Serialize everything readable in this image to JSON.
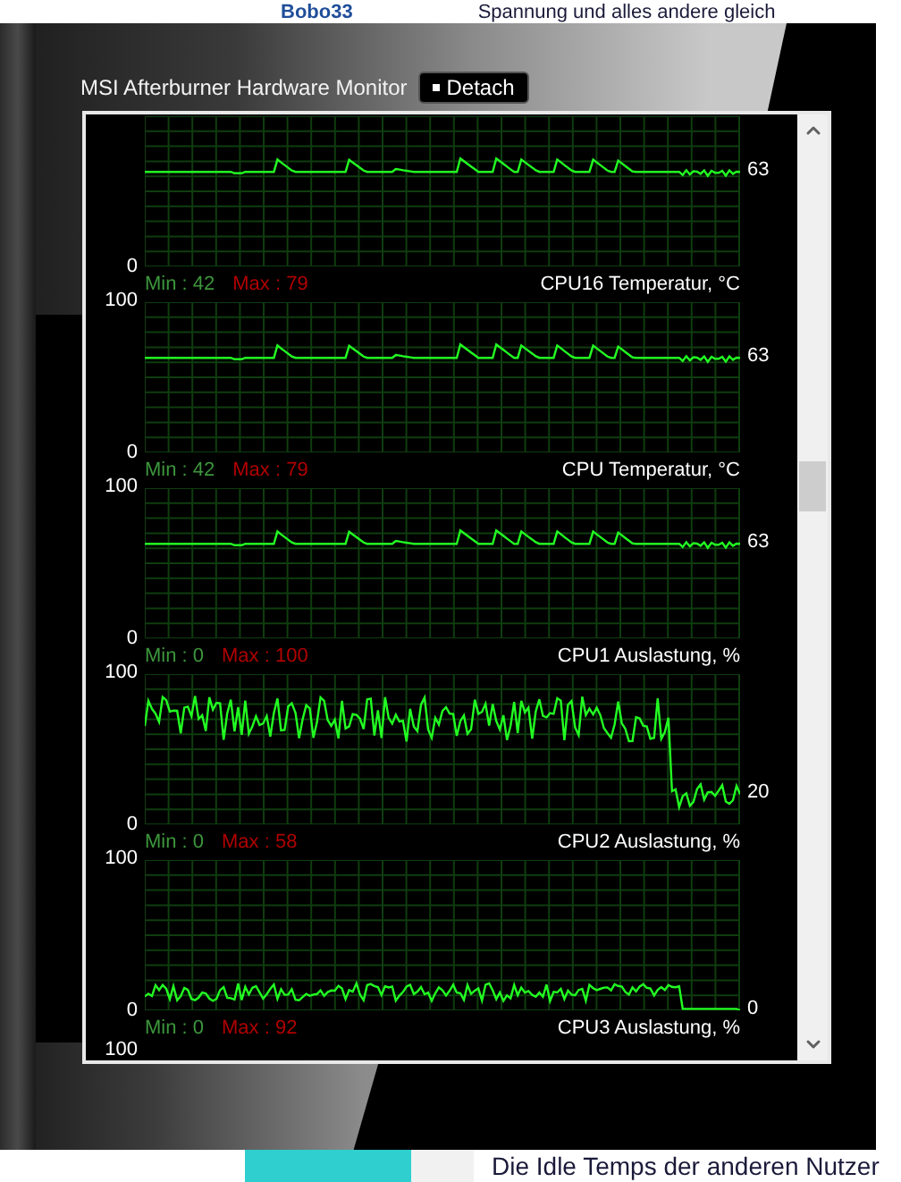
{
  "background_page": {
    "top_author": "Bobo33",
    "top_text": "Spannung und alles andere gleich",
    "bottom_text": "Die Idle Temps der anderen Nutzer"
  },
  "window": {
    "title": "MSI Afterburner Hardware Monitor",
    "detach_button": "Detach"
  },
  "graphs": [
    {
      "kind": "temperature",
      "scale_min": "0",
      "current": "63",
      "min": "Min : 42",
      "max": "Max : 79",
      "title": "CPU16 Temperatur, °C"
    },
    {
      "kind": "temperature",
      "scale_max": "100",
      "scale_min": "0",
      "current": "63",
      "min": "Min : 42",
      "max": "Max : 79",
      "title": "CPU Temperatur, °C"
    },
    {
      "kind": "temperature",
      "scale_max": "100",
      "scale_min": "0",
      "current": "63",
      "min": "Min : 0",
      "max": "Max : 100",
      "title": "CPU1 Auslastung, %"
    },
    {
      "kind": "load_drop",
      "scale_max": "100",
      "scale_min": "0",
      "current": "20",
      "min": "Min : 0",
      "max": "Max : 58",
      "title": "CPU2 Auslastung, %"
    },
    {
      "kind": "load_low",
      "scale_max": "100",
      "scale_min": "0",
      "current": "0",
      "min": "Min : 0",
      "max": "Max : 92",
      "title": "CPU3 Auslastung, %"
    },
    {
      "kind": "scale_only",
      "scale_max": "100"
    }
  ]
}
